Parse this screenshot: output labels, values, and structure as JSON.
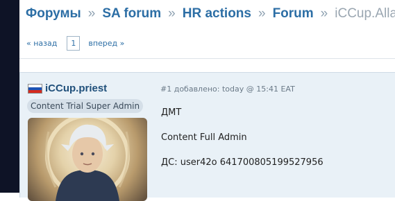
{
  "breadcrumb": {
    "items": [
      "Форумы",
      "SA forum",
      "HR actions",
      "Forum"
    ],
    "separator": "»",
    "current": "iCCup.Alladin"
  },
  "pager": {
    "prev": "« назад",
    "page": "1",
    "next": "вперед »"
  },
  "post": {
    "author": "iCCup.priest",
    "flag_colors": [
      "#ffffff",
      "#1c52b4",
      "#d52b1e"
    ],
    "role": "Content Trial Super Admin",
    "meta": "#1 добавлено: today @ 15:41 EAT",
    "lines": [
      "ДМТ",
      "Content Full Admin",
      "ДС: user42o 641700805199527956"
    ]
  },
  "colors": {
    "accent": "#2c6ea5",
    "post_bg": "#e9f1f7",
    "sidebar_dark": "#0e1326"
  }
}
